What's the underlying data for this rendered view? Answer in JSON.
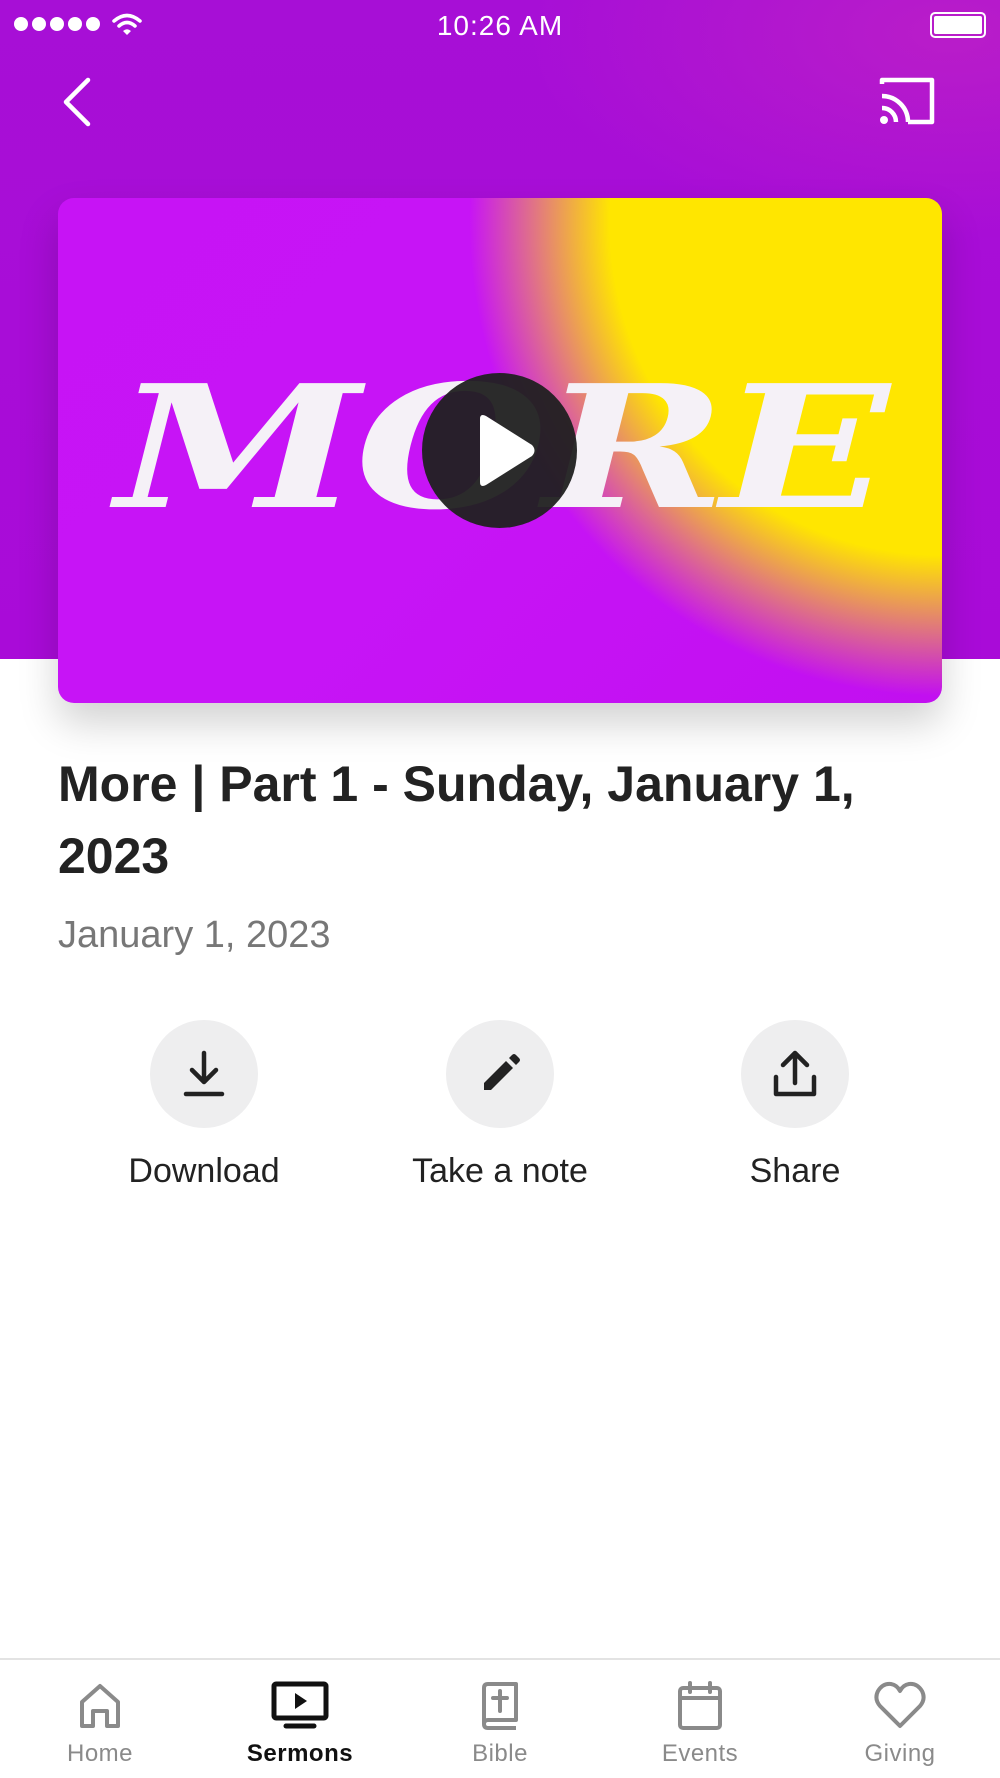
{
  "status_bar": {
    "time": "10:26 AM"
  },
  "header": {
    "back_icon": "chevron-left-icon",
    "cast_icon": "cast-icon"
  },
  "artwork": {
    "title_text": "MORE",
    "play_icon": "play-icon"
  },
  "sermon": {
    "title": "More | Part 1 - Sunday, January 1, 2023",
    "date": "January 1, 2023"
  },
  "actions": [
    {
      "label": "Download",
      "icon": "download-icon"
    },
    {
      "label": "Take a note",
      "icon": "pencil-icon"
    },
    {
      "label": "Share",
      "icon": "share-icon"
    }
  ],
  "tabs": [
    {
      "label": "Home",
      "icon": "home-icon",
      "active": false
    },
    {
      "label": "Sermons",
      "icon": "tv-play-icon",
      "active": true
    },
    {
      "label": "Bible",
      "icon": "bible-icon",
      "active": false
    },
    {
      "label": "Events",
      "icon": "calendar-icon",
      "active": false
    },
    {
      "label": "Giving",
      "icon": "heart-icon",
      "active": false
    }
  ],
  "colors": {
    "header_purple": "#a70fd6",
    "accent_yellow": "#ffe600",
    "active_tab": "#111111",
    "inactive_tab": "#8a8a8a"
  }
}
